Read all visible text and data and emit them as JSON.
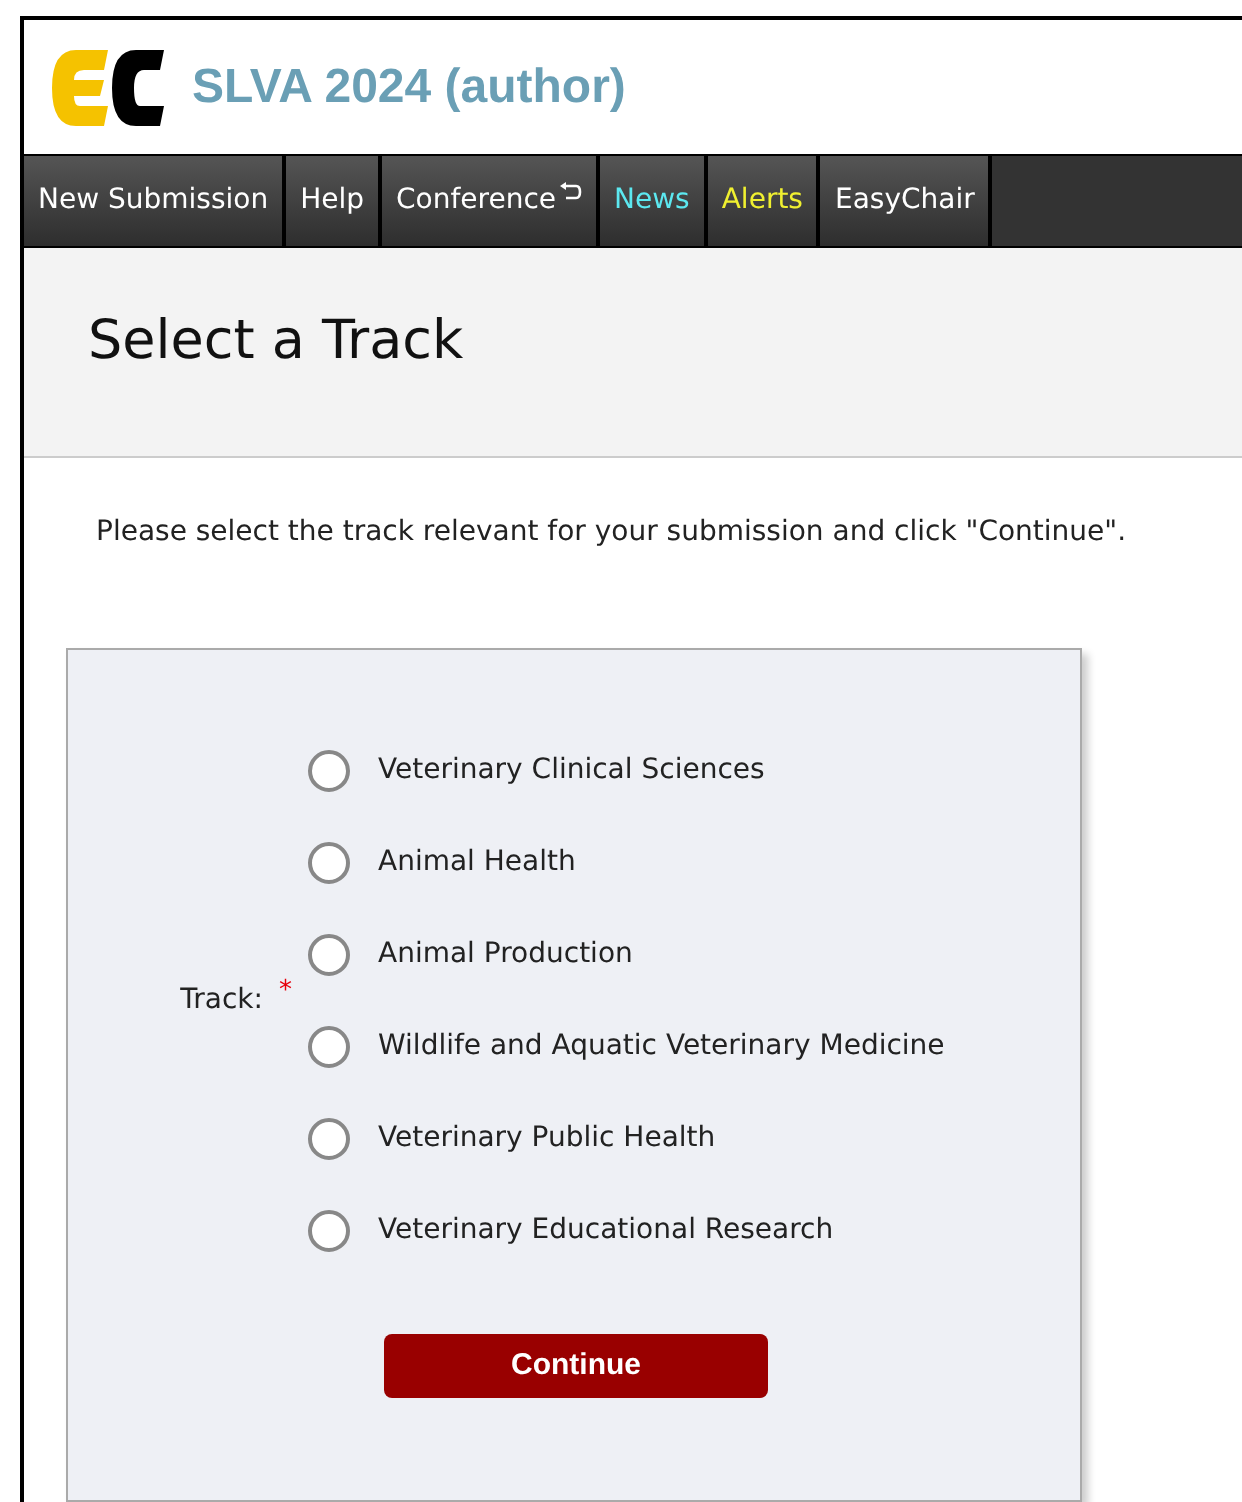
{
  "header": {
    "title": "SLVA 2024 (author)"
  },
  "nav": [
    {
      "label": "New Submission",
      "kind": "plain"
    },
    {
      "label": "Help",
      "kind": "plain"
    },
    {
      "label": "Conference",
      "kind": "switch"
    },
    {
      "label": "News",
      "kind": "news"
    },
    {
      "label": "Alerts",
      "kind": "alerts"
    },
    {
      "label": "EasyChair",
      "kind": "plain"
    }
  ],
  "page_title": "Select a Track",
  "instruction": "Please select the track relevant for your submission and click \"Continue\".",
  "form": {
    "label": "Track:",
    "required_mark": "*",
    "options": [
      {
        "label": "Veterinary Clinical Sciences",
        "selected": false
      },
      {
        "label": "Animal Health",
        "selected": false
      },
      {
        "label": "Animal Production",
        "selected": false
      },
      {
        "label": "Wildlife and Aquatic Veterinary Medicine",
        "selected": false
      },
      {
        "label": "Veterinary Public Health",
        "selected": false
      },
      {
        "label": "Veterinary Educational Research",
        "selected": false
      }
    ],
    "button": "Continue"
  }
}
